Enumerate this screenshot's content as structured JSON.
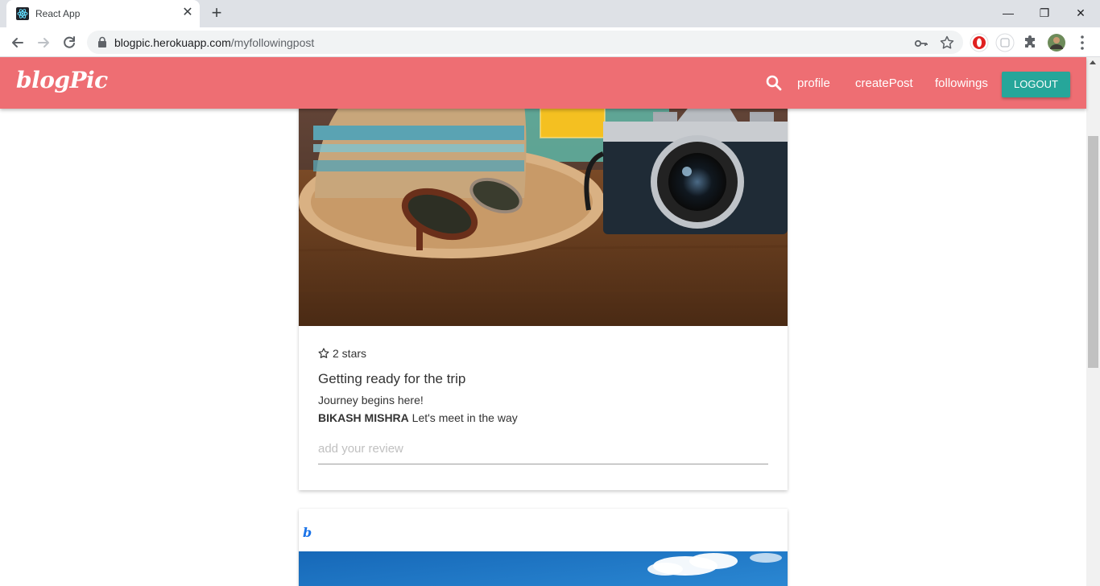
{
  "browser": {
    "tab_title": "React App",
    "url_domain": "blogpic.herokuapp.com",
    "url_path": "/myfollowingpost",
    "tab_close": "✕",
    "new_tab": "+",
    "minimize": "—",
    "restore": "❐",
    "close": "✕"
  },
  "navbar": {
    "brand": "blogPic",
    "links": [
      "profile",
      "createPost",
      "followings"
    ],
    "logout_label": "LOGOUT",
    "color": "#ee6e73",
    "button_color": "#26a69a"
  },
  "posts": [
    {
      "stars": "2 stars",
      "title": "Getting ready for the trip",
      "body": "Journey begins here!",
      "comment_author": "BIKASH MISHRA",
      "comment_text": "Let's meet in the way",
      "review_placeholder": "add your review"
    },
    {
      "author_logo": "b"
    }
  ]
}
